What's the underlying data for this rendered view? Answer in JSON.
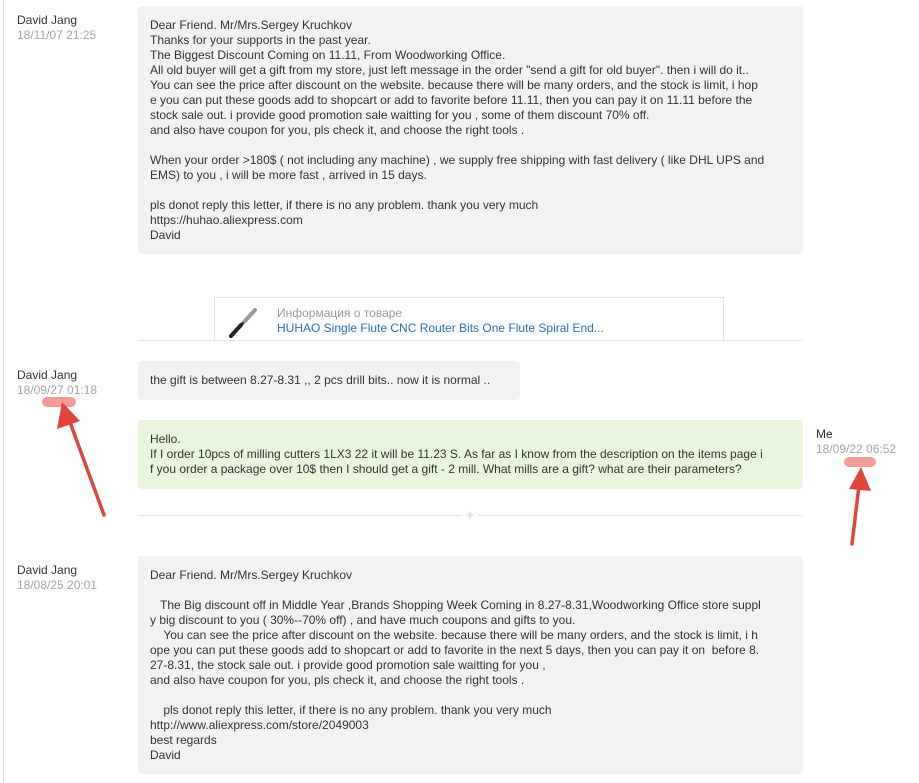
{
  "messages": [
    {
      "sender": "David Jang",
      "time": "18/11/07 21:25",
      "text": "Dear Friend. Mr/Mrs.Sergey Kruchkov\nThanks for your supports in the past year.\nThe Biggest Discount Coming on 11.11, From Woodworking Office.\nAll old buyer will get a gift from my store, just left message in the order \"send a gift for old buyer\". then i will do it..\nYou can see the price after discount on the website. because there will be many orders, and the stock is limit, i hop\ne you can put these goods add to shopcart or add to favorite before 11.11, then you can pay it on 11.11 before the\nstock sale out. i provide good promotion sale waitting for you , some of them discount 70% off.\nand also have coupon for you, pls check it, and choose the right tools .\n\nWhen your order >180$ ( not including any machine) , we supply free shipping with fast delivery ( like DHL UPS and\nEMS) to you , i will be more fast , arrived in 15 days.\n\npls donot reply this letter, if there is no any problem. thank you very much\nhttps://huhao.aliexpress.com\nDavid"
    },
    {
      "sender": "David Jang",
      "time": "18/09/27 01:18",
      "text": "the gift is between 8.27-8.31 ,, 2 pcs drill bits.. now it is normal .."
    },
    {
      "sender": "Me",
      "time": "18/09/22 06:52",
      "text": "Hello.\nIf I order 10pcs of milling cutters 1LX3 22 it will be 11.23 S. As far as I know from the description on the items page i\nf you order a package over 10$ then I should get a gift - 2 mill. What mills are a gift? what are their parameters?"
    },
    {
      "sender": "David Jang",
      "time": "18/08/25 20:01",
      "text": "Dear Friend. Mr/Mrs.Sergey Kruchkov\n\n   The Big discount off in Middle Year ,Brands Shopping Week Coming in 8.27-8.31,Woodworking Office store suppl\ny big discount to you ( 30%--70% off) , and have much coupons and gifts to you.\n    You can see the price after discount on the website. because there will be many orders, and the stock is limit, i h\nope you can put these goods add to shopcart or add to favorite in the next 5 days, then you can pay it on  before 8.\n27-8.31, the stock sale out. i provide good promotion sale waitting for you ,\nand also have coupon for you, pls check it, and choose the right tools .\n\n    pls donot reply this letter, if there is no any problem. thank you very much\nhttp://www.aliexpress.com/store/2049003\nbest regards\nDavid"
    }
  ],
  "product_card": {
    "label": "Информация о товаре",
    "title": "HUHAO Single Flute CNC Router Bits One Flute Spiral End..."
  },
  "icons": {
    "product_thumb": "router-bit-icon",
    "divider": "star-divider-icon",
    "annotation": "red-arrow-icon"
  },
  "colors": {
    "bubble_other": "#f2f2f2",
    "bubble_me": "#e9f5dc",
    "link": "#2a6fb7",
    "timestamp": "#a6a6a6",
    "annotation": "#e0463f"
  }
}
